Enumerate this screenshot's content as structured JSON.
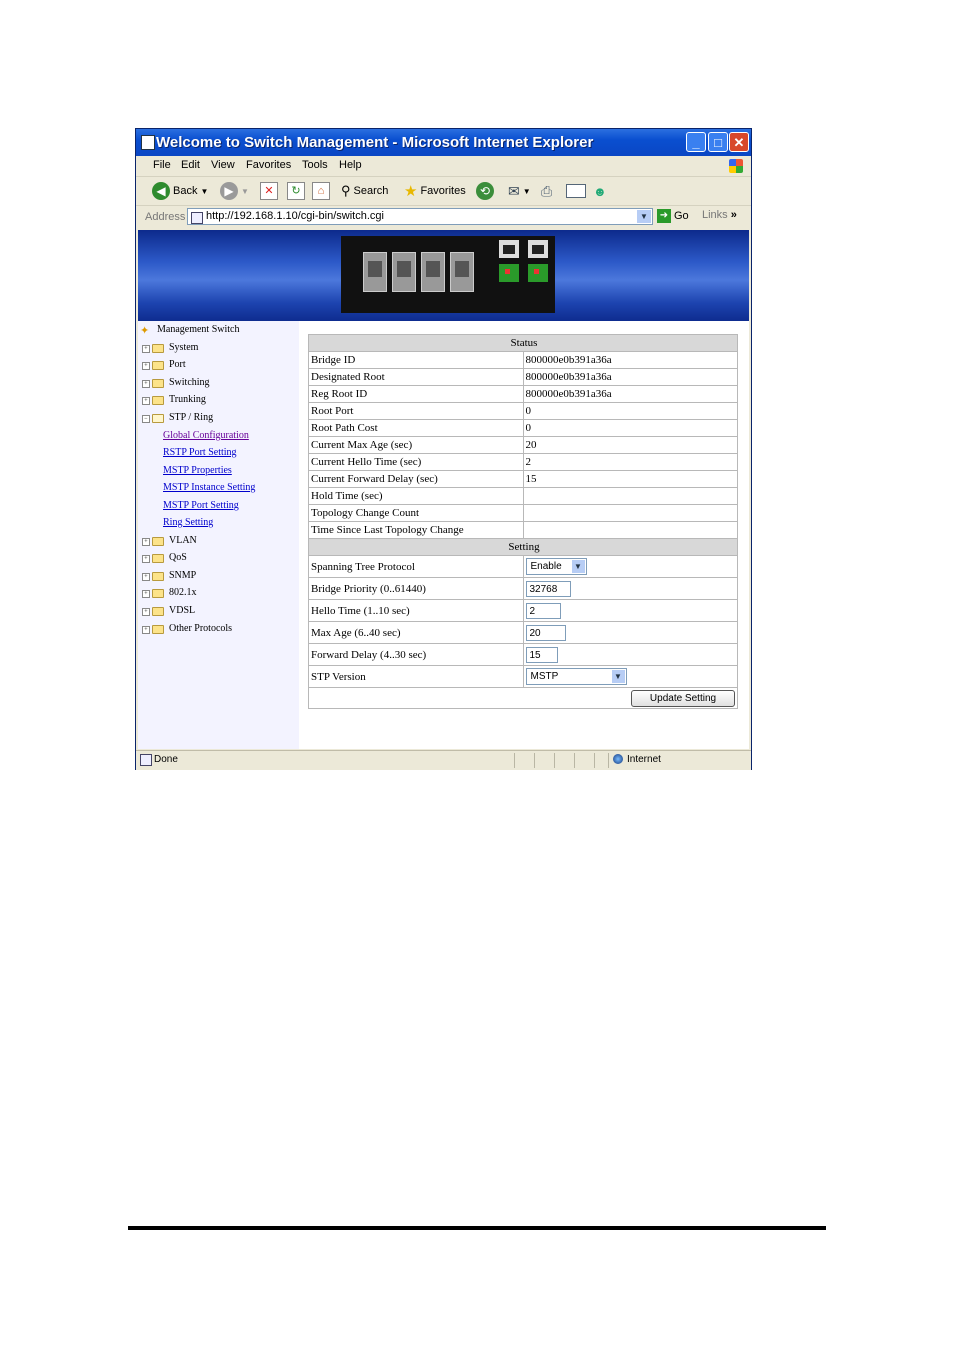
{
  "window": {
    "title": "Welcome to Switch Management - Microsoft Internet Explorer",
    "minimize_glyph": "_",
    "maximize_glyph": "□",
    "close_glyph": "✕"
  },
  "menu": [
    "File",
    "Edit",
    "View",
    "Favorites",
    "Tools",
    "Help"
  ],
  "toolbar": {
    "back": "Back",
    "search": "Search",
    "favorites": "Favorites"
  },
  "address": {
    "label": "Address",
    "url": "http://192.168.1.10/cgi-bin/switch.cgi",
    "go": "Go",
    "links": "Links",
    "more": "»"
  },
  "sidebar": {
    "root": "Management Switch",
    "items": [
      {
        "label": "System"
      },
      {
        "label": "Port"
      },
      {
        "label": "Switching"
      },
      {
        "label": "Trunking"
      },
      {
        "label": "STP / Ring"
      }
    ],
    "stp_children": [
      {
        "label": "Global Configuration"
      },
      {
        "label": "RSTP Port Setting"
      },
      {
        "label": "MSTP Properties"
      },
      {
        "label": "MSTP Instance Setting"
      },
      {
        "label": "MSTP Port Setting"
      },
      {
        "label": "Ring Setting"
      }
    ],
    "items_after": [
      {
        "label": "VLAN"
      },
      {
        "label": "QoS"
      },
      {
        "label": "SNMP"
      },
      {
        "label": "802.1x"
      },
      {
        "label": "VDSL"
      },
      {
        "label": "Other Protocols"
      }
    ]
  },
  "status": {
    "header": "Status",
    "rows": [
      {
        "label": "Bridge ID",
        "value": "800000e0b391a36a"
      },
      {
        "label": "Designated Root",
        "value": "800000e0b391a36a"
      },
      {
        "label": "Reg Root ID",
        "value": "800000e0b391a36a"
      },
      {
        "label": "Root Port",
        "value": "0"
      },
      {
        "label": "Root Path Cost",
        "value": "0"
      },
      {
        "label": "Current Max Age (sec)",
        "value": "20"
      },
      {
        "label": "Current Hello Time (sec)",
        "value": "2"
      },
      {
        "label": "Current Forward Delay (sec)",
        "value": "15"
      },
      {
        "label": "Hold Time (sec)",
        "value": ""
      },
      {
        "label": "Topology Change Count",
        "value": ""
      },
      {
        "label": "Time Since Last Topology Change",
        "value": ""
      }
    ]
  },
  "setting": {
    "header": "Setting",
    "spanning_tree": {
      "label": "Spanning Tree Protocol",
      "value": "Enable"
    },
    "bridge_priority": {
      "label": "Bridge Priority (0..61440)",
      "value": "32768"
    },
    "hello_time": {
      "label": "Hello Time (1..10 sec)",
      "value": "2"
    },
    "max_age": {
      "label": "Max Age (6..40 sec)",
      "value": "20"
    },
    "forward_delay": {
      "label": "Forward Delay (4..30 sec)",
      "value": "15"
    },
    "stp_version": {
      "label": "STP Version",
      "value": "MSTP"
    },
    "update_button": "Update Setting"
  },
  "statusbar": {
    "left": "Done",
    "zone": "Internet"
  }
}
